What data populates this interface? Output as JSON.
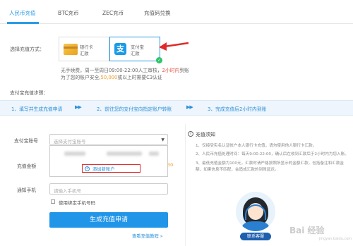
{
  "tabs": [
    {
      "label": "人民币充值",
      "active": true
    },
    {
      "label": "BTC充币",
      "active": false
    },
    {
      "label": "ZEC充币",
      "active": false
    },
    {
      "label": "充值码兑换",
      "active": false
    }
  ],
  "payment": {
    "label": "选择充值方式：",
    "methods": [
      {
        "line1": "银行卡",
        "line2": "汇款",
        "icon": "bank-card-icon",
        "selected": false
      },
      {
        "line1": "支付宝",
        "line2": "汇款",
        "icon": "alipay-icon",
        "selected": true
      }
    ]
  },
  "info": {
    "line1_prefix": "无手续费，周一至周日09:00-22:00人工审核，",
    "line1_red": "2小时内",
    "line1_suffix": "到账",
    "line2_prefix": "为了您的账户安全,",
    "line2_orange": "50,000",
    "line2_suffix": "或以上时需要C3认证"
  },
  "steps": {
    "title": "支付宝充值步骤：",
    "items": [
      "1、填写并生成充值申请",
      "2、前往您的支付宝向指定账户转账",
      "3、完成充值后2小时内到账"
    ],
    "arrow": "▶▶"
  },
  "form": {
    "account_label": "支付宝账号",
    "account_placeholder": "选择支付宝账号",
    "add_account": "添加新账户",
    "amount_label": "充值金额",
    "amount_hint": "30",
    "phone_label": "通知手机",
    "phone_placeholder": "请输入手机号",
    "bind_phone_label": "使用绑定手机号码",
    "submit_label": "生成充值申请",
    "tutorial_label": "查看充值教程 »"
  },
  "notice": {
    "title": "充值须知",
    "items": [
      "1、仅接受实名认证帐户本人银行卡充值，请勿使用他人银行卡汇款。",
      "2、人民币充值处理时间：每天9:00-22:00，确认后在收到汇款后于2小时内为您入账。",
      "3、最低充值金额为100元，汇款时请严格按照所显示的金额汇款，包括备注和汇款金额，如果信息不匹配，会造成汇款的到账延迟。"
    ],
    "contact_label": "联系客服"
  },
  "watermark": {
    "main": "Bai 经验",
    "sub": "jingyan.baidu.com"
  },
  "colors": {
    "accent": "#2a9be6",
    "highlight": "#e0292a",
    "button": "#2196e9"
  }
}
